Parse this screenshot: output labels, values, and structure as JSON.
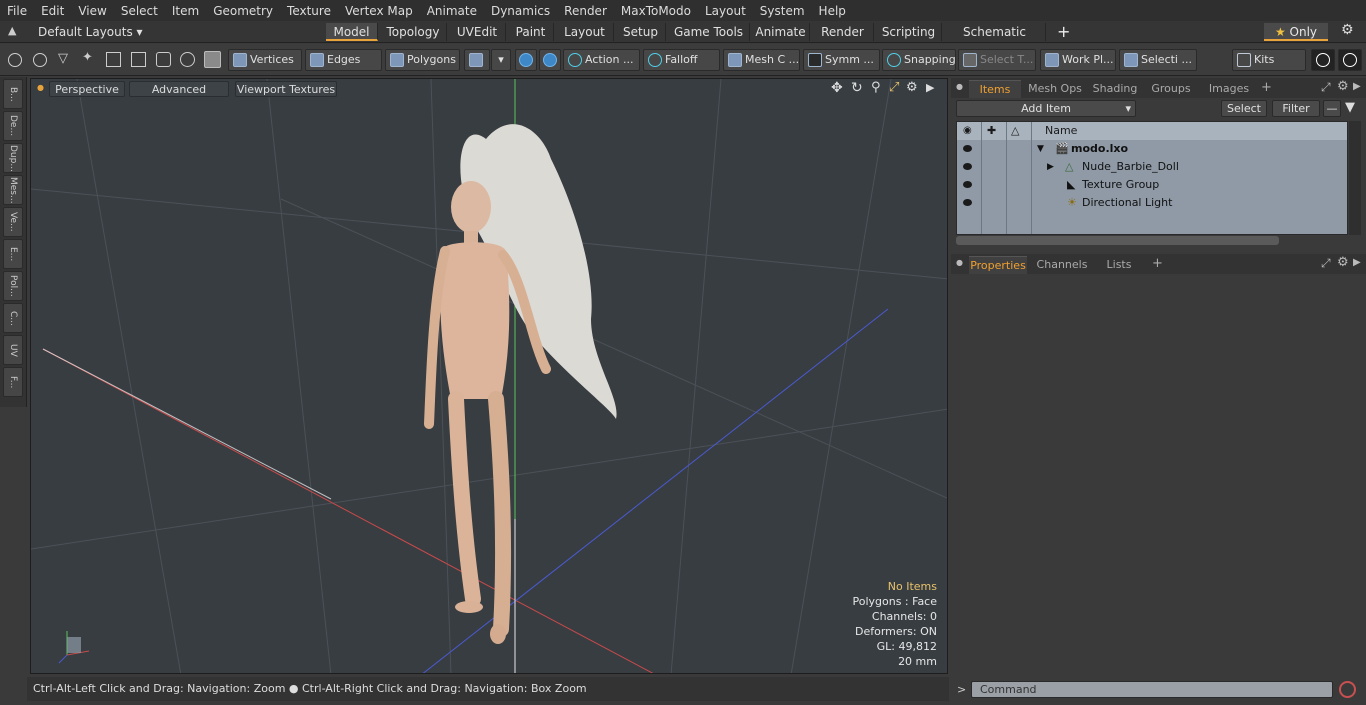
{
  "menu": [
    "File",
    "Edit",
    "View",
    "Select",
    "Item",
    "Geometry",
    "Texture",
    "Vertex Map",
    "Animate",
    "Dynamics",
    "Render",
    "MaxToModo",
    "Layout",
    "System",
    "Help"
  ],
  "layouts": {
    "preset": "Default Layouts",
    "tabs": [
      "Model",
      "Topology",
      "UVEdit",
      "Paint",
      "Layout",
      "Setup",
      "Game Tools",
      "Animate",
      "Render",
      "Scripting",
      "Schematic Fusion"
    ],
    "active": "Model",
    "add": "+",
    "only": "Only"
  },
  "toolbar": {
    "vertices": "Vertices",
    "edges": "Edges",
    "polygons": "Polygons",
    "action": "Action",
    "falloff": "Falloff",
    "mesh": "Mesh C ...",
    "symm": "Symm ...",
    "snapping": "Snapping",
    "select_t": "Select T...",
    "work_pl": "Work Pl...",
    "selecti": "Selecti ...",
    "kits": "Kits"
  },
  "sidetabs": [
    "B...",
    "De...",
    "Dup...",
    "Mes...",
    "Ve...",
    "E...",
    "Pol...",
    "C...",
    "UV",
    "F..."
  ],
  "viewport": {
    "perspective": "Perspective",
    "advanced": "Advanced",
    "textures": "Viewport Textures",
    "stats": {
      "no_items": "No Items",
      "polygons": "Polygons : Face",
      "channels": "Channels: 0",
      "deformers": "Deformers: ON",
      "gl": "GL: 49,812",
      "scale": "20 mm"
    }
  },
  "status": "Ctrl-Alt-Left Click and Drag: Navigation: Zoom ● Ctrl-Alt-Right Click and Drag: Navigation: Box Zoom",
  "items_panel": {
    "tabs": [
      "Items",
      "Mesh Ops",
      "Shading",
      "Groups",
      "Images"
    ],
    "active": "Items",
    "add_item": "Add Item",
    "select": "Select",
    "filter": "Filter",
    "name_col": "Name",
    "rows": [
      "modo.lxo",
      "Nude_Barbie_Doll",
      "Texture Group",
      "Directional Light"
    ]
  },
  "props_panel": {
    "tabs": [
      "Properties",
      "Channels",
      "Lists"
    ],
    "active": "Properties"
  },
  "command": {
    "placeholder": "Command",
    "prompt": ">"
  },
  "colors": {
    "accent": "#e8a33a",
    "viewport_bg": "#383d42",
    "axis_x": "#c84a4a",
    "axis_y": "#59c35a",
    "axis_z": "#4a5ad0"
  }
}
